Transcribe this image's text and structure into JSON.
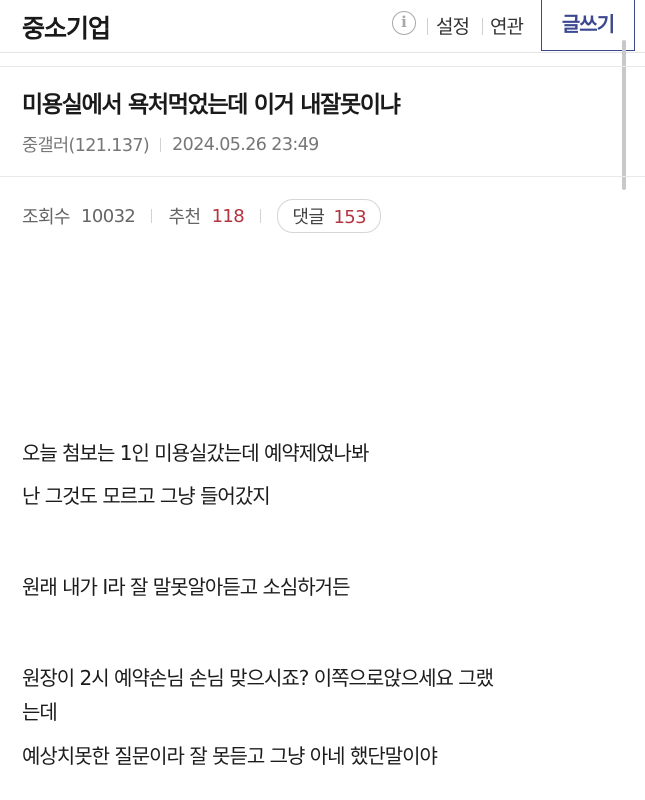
{
  "topbar": {
    "gallery_name": "중소기업",
    "info_icon_glyph": "i",
    "settings_label": "설정",
    "related_label": "연관",
    "write_label": "글쓰기"
  },
  "post": {
    "title": "미용실에서 욕처먹었는데 이거 내잘못이냐",
    "author": "중갤러(121.137)",
    "datetime": "2024.05.26 23:49",
    "views_label": "조회수",
    "views": "10032",
    "recommend_label": "추천",
    "recommend": "118",
    "comments_label": "댓글",
    "comments": "153"
  },
  "body": {
    "lines": [
      "오늘 첨보는 1인 미용실갔는데 예약제였나봐",
      "난 그것도 모르고 그냥 들어갔지",
      "원래 내가 I라 잘 말못알아듣고 소심하거든",
      "원장이 2시 예약손님 손님 맞으시죠? 이쪽으로앉으세요 그랬",
      "는데",
      "예상치못한 질문이라 잘 못듣고 그냥 아네 했단말이야"
    ]
  },
  "icons": {
    "info": "info-circle-icon"
  },
  "colors": {
    "accent": "#3b4890",
    "count_red": "#b3343f"
  }
}
